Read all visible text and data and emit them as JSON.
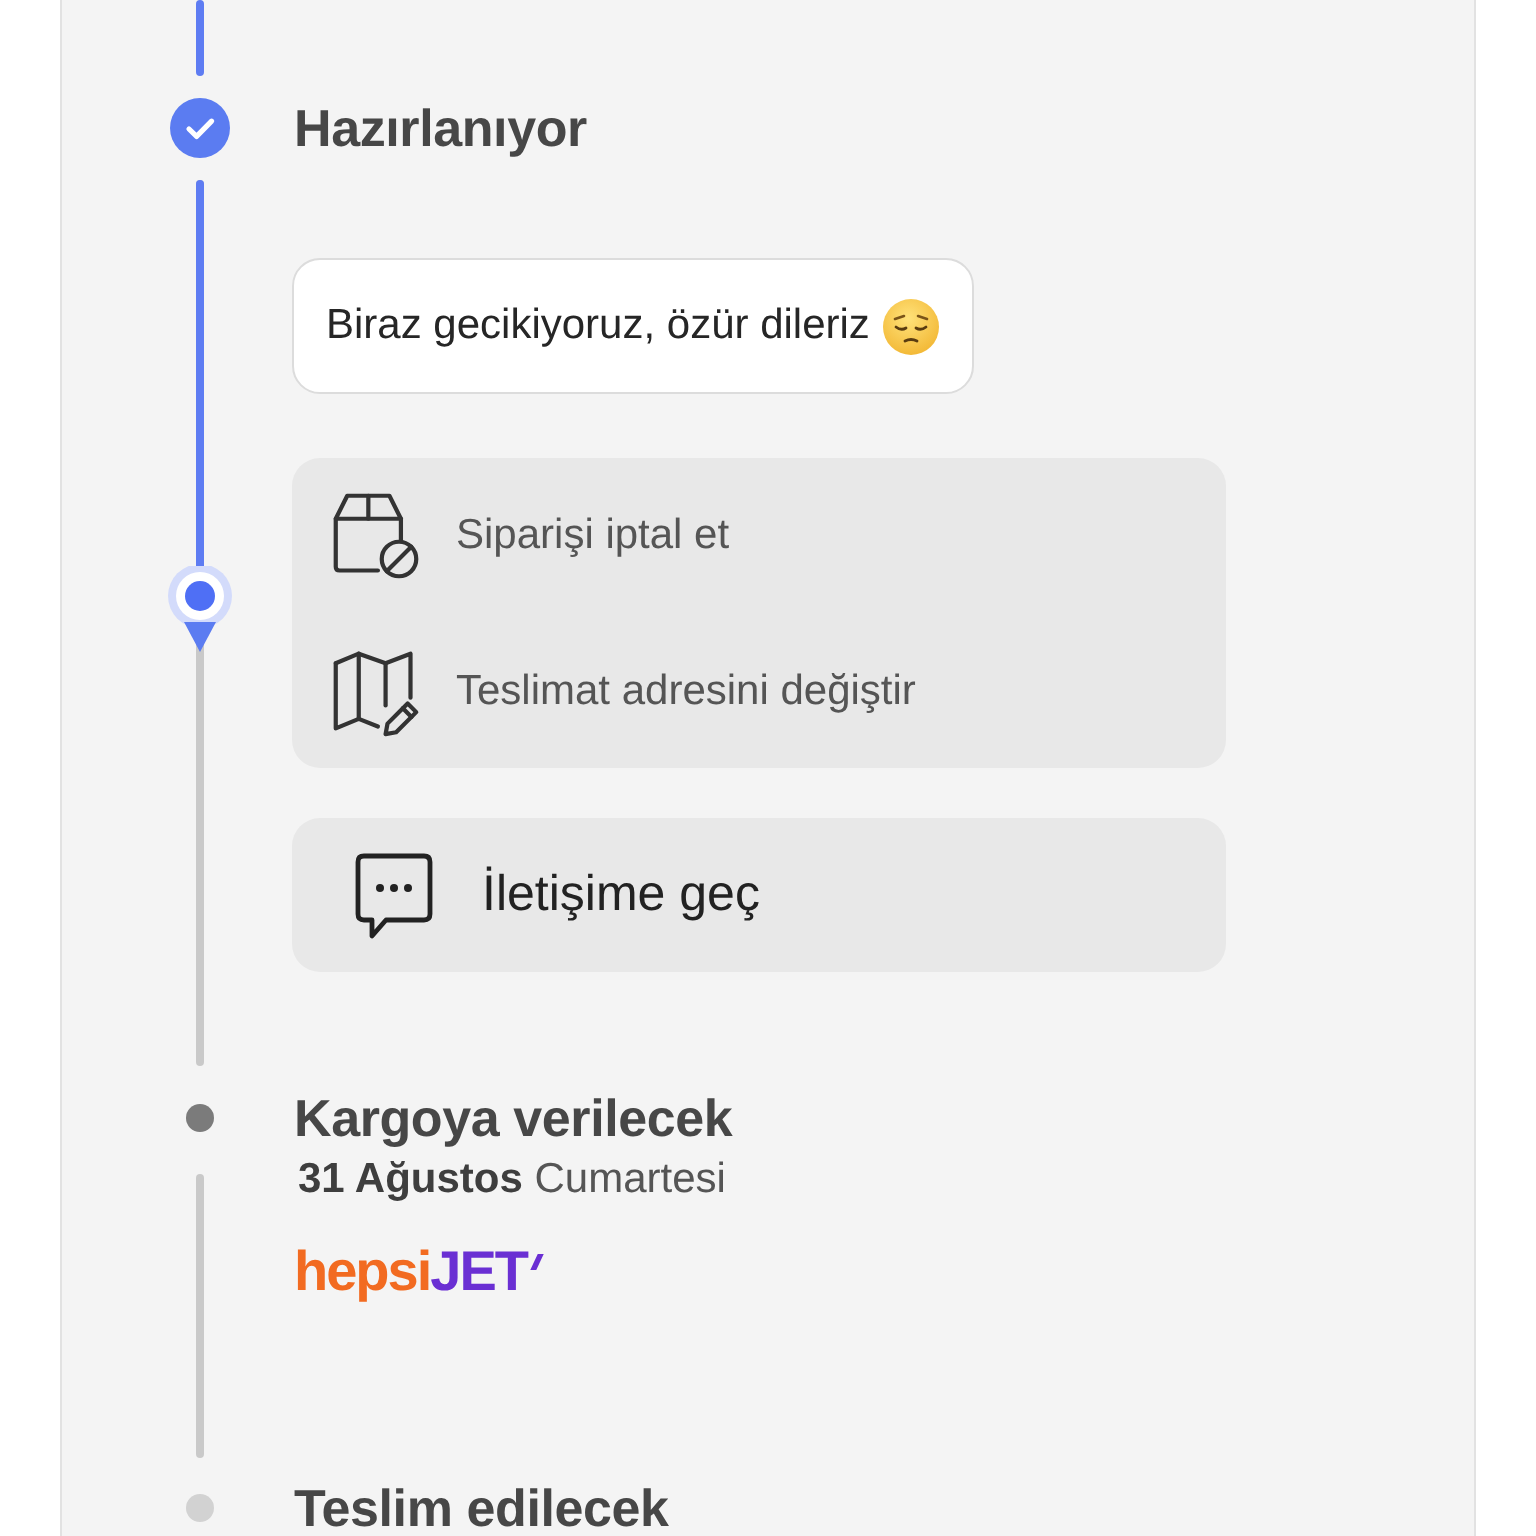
{
  "timeline": {
    "lead_in": {
      "completed": true
    },
    "steps": [
      {
        "kind": "done",
        "title": "Hazırlanıyor",
        "message": "Biraz gecikiyoruz, özür dileriz",
        "actions": [
          {
            "kind": "cancel",
            "label": "Siparişi iptal et"
          },
          {
            "kind": "address",
            "label": "Teslimat adresini değiştir"
          }
        ],
        "contact_button": {
          "label": "İletişime geç"
        },
        "progress": {
          "level": 0.47
        }
      },
      {
        "kind": "next",
        "title": "Kargoya verilecek",
        "date": "**31 Ağustos** Cumartesi",
        "carrier_logo": [
          "hepsi",
          "JET"
        ]
      },
      {
        "kind": "later",
        "title": "Teslim edilecek"
      }
    ]
  }
}
